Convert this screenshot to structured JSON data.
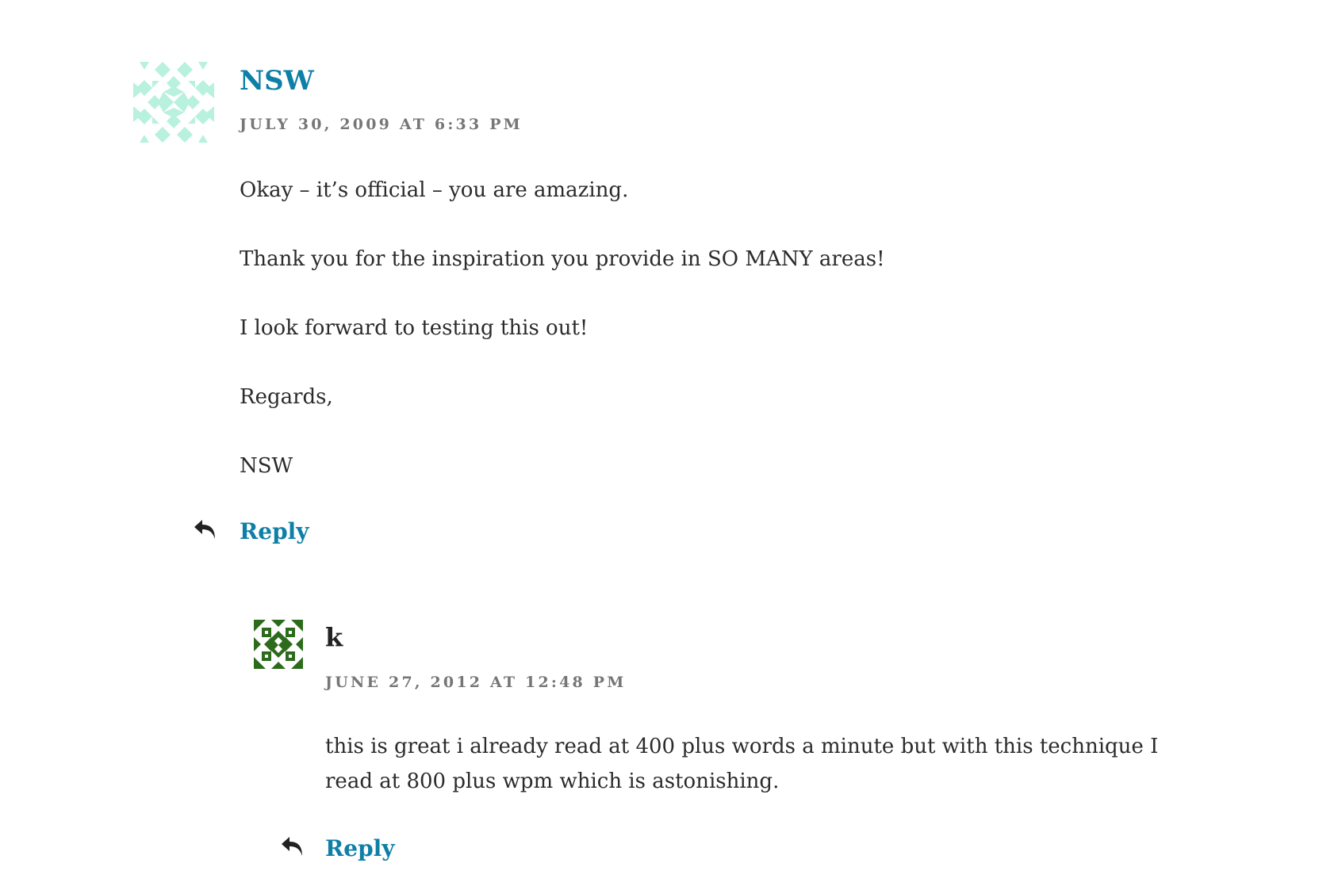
{
  "comments": [
    {
      "author": "NSW",
      "date": "July 30, 2009 at 6:33 PM",
      "paragraphs": [
        "Okay – it’s official – you are amazing.",
        "Thank you for the inspiration you provide in SO MANY areas!",
        "I look forward to testing this out!",
        "Regards,",
        "NSW"
      ],
      "reply_label": "Reply",
      "avatar_color": "#b8f1dd"
    },
    {
      "author": "k",
      "date": "June 27, 2012 at 12:48 PM",
      "paragraphs": [
        "this is great i already read at 400 plus words a minute but with this technique I read at 800 plus wpm which is astonishing."
      ],
      "reply_label": "Reply",
      "avatar_color": "#2d6b1c"
    }
  ],
  "colors": {
    "link": "#0e7fa6",
    "meta": "#767676",
    "text": "#2b2b2b"
  }
}
